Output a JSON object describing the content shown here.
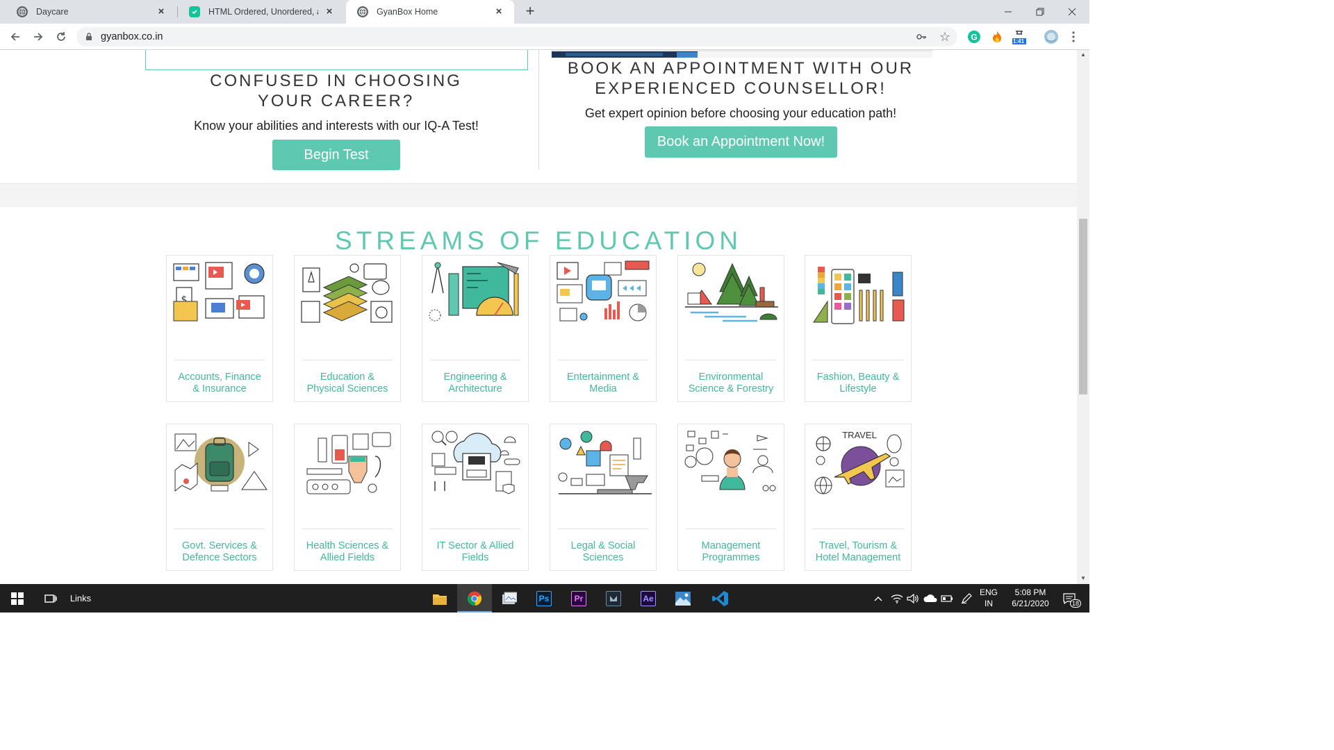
{
  "browser": {
    "tabs": [
      {
        "title": "Daycare",
        "active": false
      },
      {
        "title": "HTML Ordered, Unordered, and D",
        "active": false
      },
      {
        "title": "GyanBox Home",
        "active": true
      }
    ],
    "url": "gyanbox.co.in",
    "extension_badge": "1:41"
  },
  "career_section": {
    "heading": "CONFUSED IN CHOOSING YOUR CAREER?",
    "subtext": "Know your abilities and interests with our IQ-A Test!",
    "button": "Begin Test"
  },
  "appointment_section": {
    "heading": "BOOK AN APPOINTMENT WITH OUR EXPERIENCED COUNSELLOR!",
    "subtext": "Get expert opinion before choosing your education path!",
    "button": "Book an Appointment Now!"
  },
  "streams": {
    "title": "STREAMS OF EDUCATION",
    "items": [
      {
        "line1": "Accounts, Finance",
        "line2": "& Insurance",
        "icon": "finance-illustration"
      },
      {
        "line1": "Education &",
        "line2": "Physical Sciences",
        "icon": "books-illustration"
      },
      {
        "line1": "Engineering &",
        "line2": "Architecture",
        "icon": "engineering-tools-illustration"
      },
      {
        "line1": "Entertainment &",
        "line2": "Media",
        "icon": "media-illustration"
      },
      {
        "line1": "Environmental",
        "line2": "Science & Forestry",
        "icon": "forest-illustration"
      },
      {
        "line1": "Fashion, Beauty &",
        "line2": "Lifestyle",
        "icon": "palette-illustration"
      },
      {
        "line1": "Govt. Services &",
        "line2": "Defence Sectors",
        "icon": "backpack-illustration"
      },
      {
        "line1": "Health Sciences &",
        "line2": "Allied Fields",
        "icon": "medical-illustration"
      },
      {
        "line1": "IT Sector & Allied",
        "line2": "Fields",
        "icon": "cloud-computing-illustration"
      },
      {
        "line1": "Legal & Social",
        "line2": "Sciences",
        "icon": "legal-illustration"
      },
      {
        "line1": "Management",
        "line2": "Programmes",
        "icon": "manager-illustration"
      },
      {
        "line1": "Travel, Tourism &",
        "line2": "Hotel Management",
        "icon": "airplane-illustration",
        "art_text": "TRAVEL"
      }
    ]
  },
  "taskbar": {
    "links_label": "Links",
    "apps": [
      "file-explorer",
      "chrome",
      "photos-viewer",
      "Ps",
      "Pr",
      "media-encoder",
      "Ae",
      "photos",
      "vscode"
    ],
    "lang_line1": "ENG",
    "lang_line2": "IN",
    "time": "5:08 PM",
    "date": "6/21/2020",
    "notification_count": "18"
  },
  "colors": {
    "accent": "#5ec9b0",
    "accent_text": "#3fb89b",
    "tab_strip": "#dee1e6",
    "taskbar": "#1f1f1f"
  }
}
